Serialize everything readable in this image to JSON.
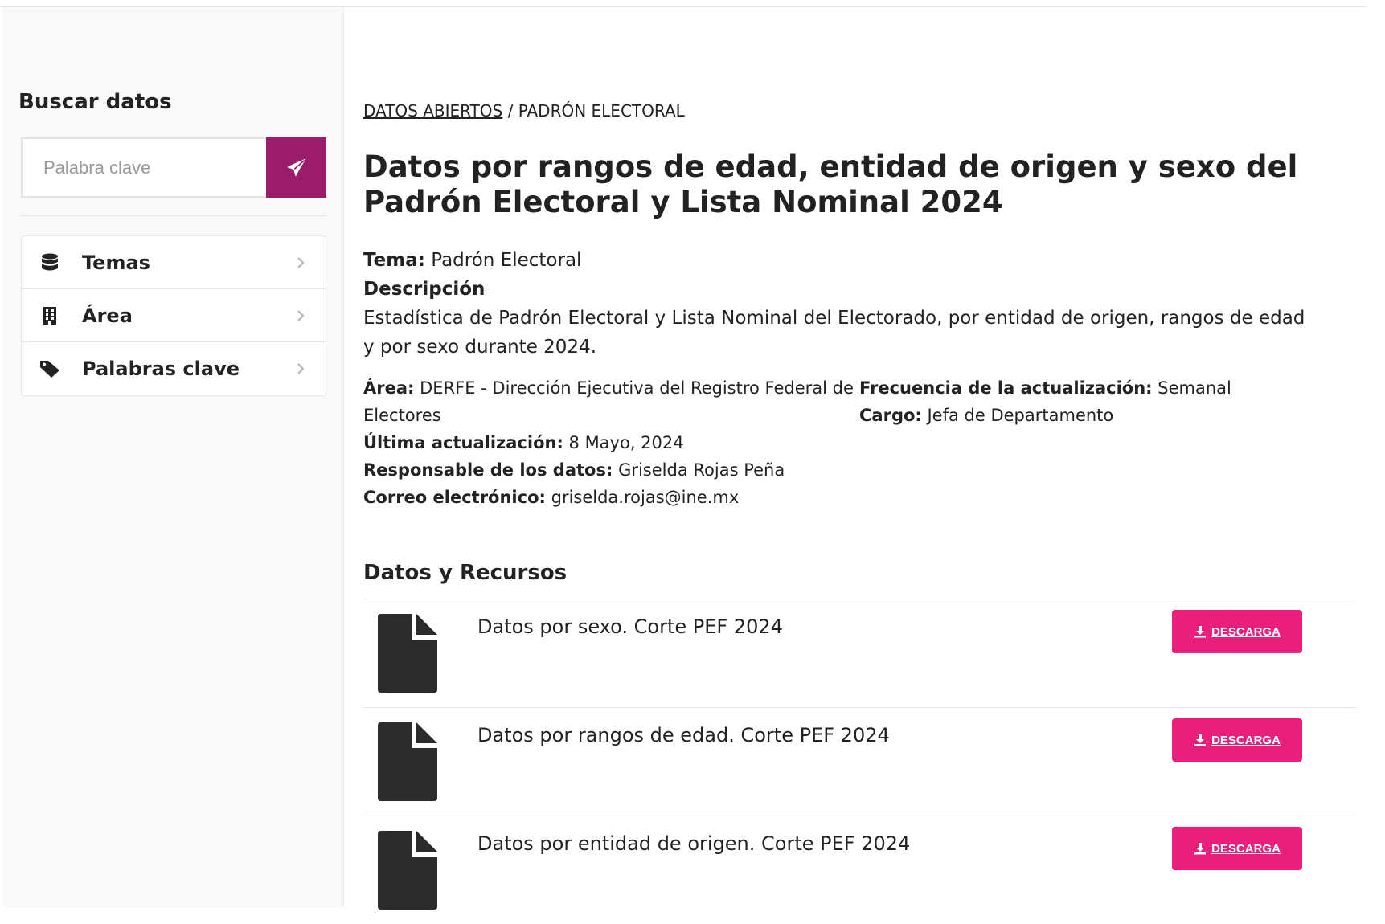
{
  "sidebar": {
    "title": "Buscar datos",
    "search_placeholder": "Palabra clave",
    "items": [
      {
        "label": "Temas",
        "icon": "database-icon"
      },
      {
        "label": "Área",
        "icon": "building-icon"
      },
      {
        "label": "Palabras clave",
        "icon": "tag-icon"
      }
    ]
  },
  "breadcrumb": {
    "link": "DATOS ABIERTOS",
    "separator": "/",
    "current": "PADRÓN ELECTORAL"
  },
  "dataset": {
    "title": "Datos por rangos de edad, entidad de origen y sexo del Padrón Electoral y Lista Nominal 2024",
    "tema_label": "Tema:",
    "tema_value": "Padrón Electoral",
    "descripcion_label": "Descripción",
    "descripcion_value": "Estadística de Padrón Electoral y Lista Nominal del Electorado, por entidad de origen, rangos de edad y por sexo durante 2024.",
    "area_label": "Área:",
    "area_value": "DERFE - Dirección Ejecutiva del Registro Federal de Electores",
    "ultima_label": "Última actualización:",
    "ultima_value": "8 Mayo, 2024",
    "responsable_label": "Responsable de los datos:",
    "responsable_value": "Griselda Rojas Peña",
    "correo_label": "Correo electrónico:",
    "correo_value": "griselda.rojas@ine.mx",
    "frecuencia_label": "Frecuencia de la actualización:",
    "frecuencia_value": "Semanal",
    "cargo_label": "Cargo:",
    "cargo_value": "Jefa de Departamento"
  },
  "resources": {
    "title": "Datos y Recursos",
    "download_label": "DESCARGA",
    "items": [
      {
        "name": "Datos por sexo. Corte PEF 2024"
      },
      {
        "name": "Datos por rangos de edad. Corte PEF 2024"
      },
      {
        "name": "Datos por entidad de origen. Corte PEF 2024"
      }
    ]
  },
  "colors": {
    "search_button": "#9b1c6a",
    "download_button": "#ea1f7c",
    "file_icon": "#2b2b2b"
  }
}
